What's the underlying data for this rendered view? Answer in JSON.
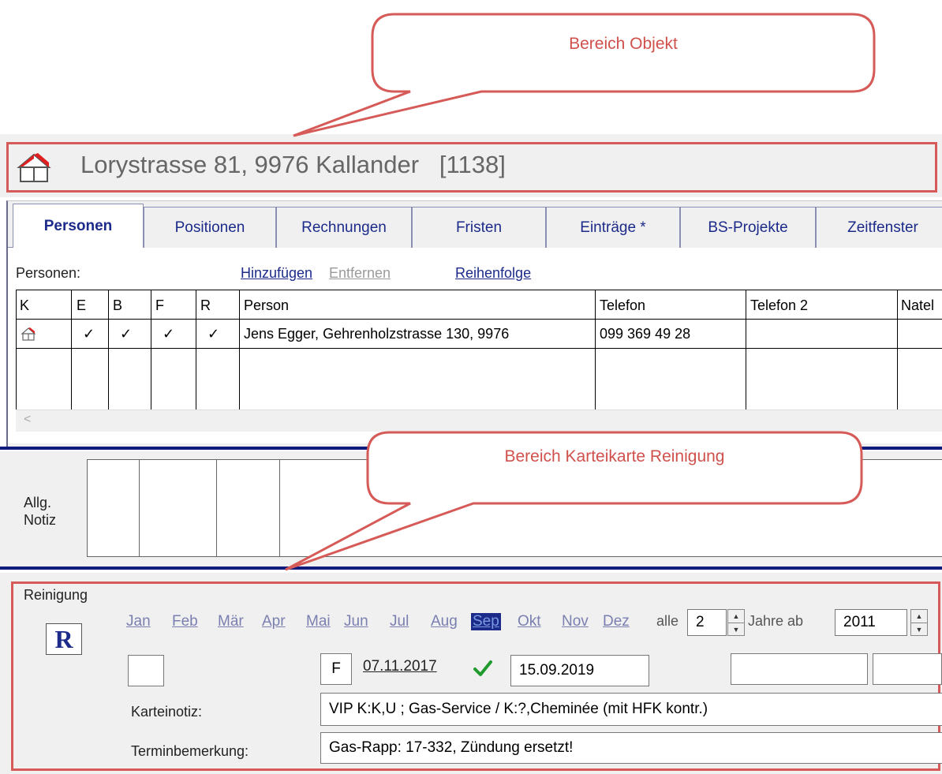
{
  "callouts": {
    "top": "Bereich Objekt",
    "middle": "Bereich Karteikarte Reinigung"
  },
  "object": {
    "title": "Lorystrasse 81, 9976 Kallander   [1138]",
    "icon": "house-icon"
  },
  "tabs": [
    {
      "label": "Personen",
      "active": true
    },
    {
      "label": "Positionen"
    },
    {
      "label": "Rechnungen"
    },
    {
      "label": "Fristen"
    },
    {
      "label": "Einträge *"
    },
    {
      "label": "BS-Projekte"
    },
    {
      "label": "Zeitfenster"
    }
  ],
  "persons": {
    "label": "Personen:",
    "add": "Hinzufügen",
    "remove": "Entfernen",
    "order": "Reihenfolge",
    "columns": [
      "K",
      "E",
      "B",
      "F",
      "R",
      "Person",
      "Telefon",
      "Telefon 2",
      "Natel"
    ],
    "rows": [
      {
        "K": "house-icon",
        "E": "✓",
        "B": "✓",
        "F": "✓",
        "R": "✓",
        "person": "Jens Egger, Gehrenholzstrasse 130, 9976",
        "telefon": "099 369 49 28",
        "telefon2": "",
        "natel": ""
      }
    ],
    "scroll_left": "<"
  },
  "note": {
    "label": "Allg.\nNotiz"
  },
  "reinigung": {
    "title": "Reinigung",
    "badge": "R",
    "months": [
      "Jan",
      "Feb",
      "Mär",
      "Apr",
      "Mai",
      "Jun",
      "Jul",
      "Aug",
      "Sep",
      "Okt",
      "Nov",
      "Dez"
    ],
    "selected_month": "Sep",
    "every_label": "alle",
    "every_value": "2",
    "years_from_label": "Jahre ab",
    "years_from_value": "2011",
    "flag": "F",
    "last_date": "07.11.2017",
    "check_icon": "check-icon",
    "next_date": "15.09.2019",
    "karteinotiz_label": "Karteinotiz:",
    "karteinotiz_value": "VIP   K:K,U ; Gas-Service / K:?,Cheminée (mit HFK kontr.)",
    "termin_label": "Terminbemerkung:",
    "termin_value": "Gas-Rapp: 17-332, Zündung ersetzt!"
  },
  "colors": {
    "callout": "#d0504c",
    "accent_blue": "#0f1a7a",
    "link": "#1c2a8a",
    "check": "#1f9a2c"
  }
}
